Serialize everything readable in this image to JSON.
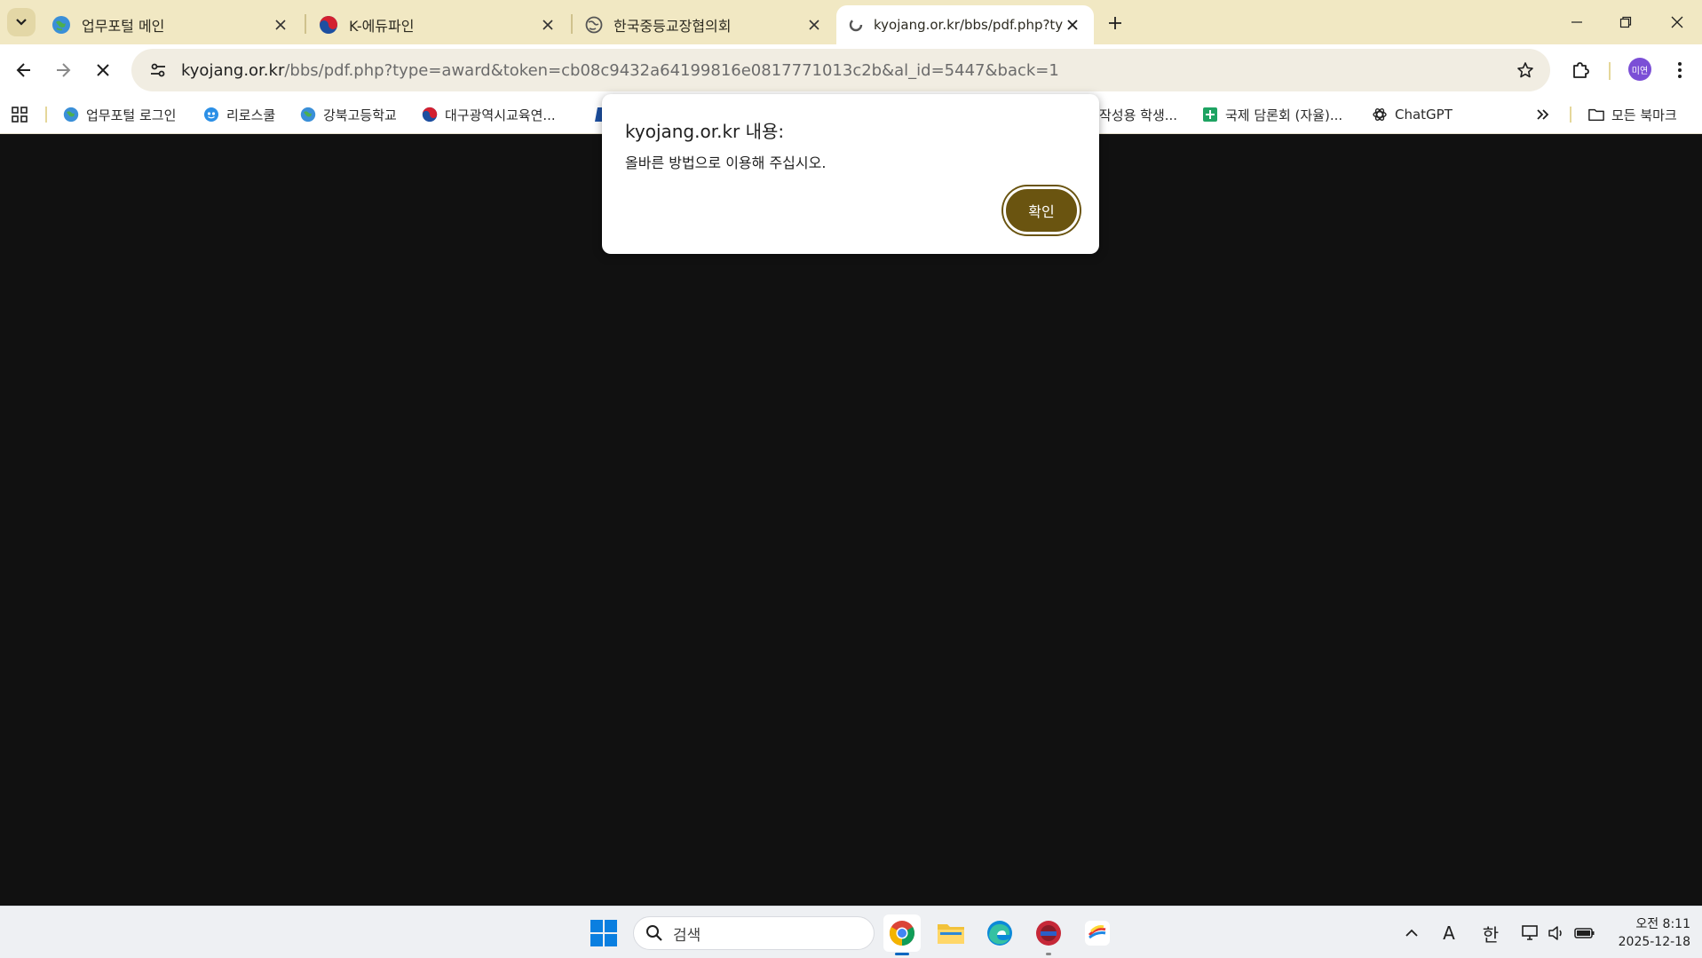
{
  "tabs": [
    {
      "title": "업무포털 메인",
      "icon": "globe-icon"
    },
    {
      "title": "K-에듀파인",
      "icon": "taegeuk-icon"
    },
    {
      "title": "한국중등교장협의회",
      "icon": "globe-gray-icon"
    },
    {
      "title": "kyojang.or.kr/bbs/pdf.php?type=award",
      "icon": "loading-icon",
      "active": true
    }
  ],
  "url": {
    "host": "kyojang.or.kr",
    "path": "/bbs/pdf.php?type=award&token=cb08c9432a64199816e0817771013c2b&al_id=5447&back=1"
  },
  "profile": {
    "initials": "미연",
    "color": "#7b4fd6"
  },
  "bookmarks": [
    {
      "label": "업무포털 로그인",
      "icon": "globe-icon"
    },
    {
      "label": "리로스쿨",
      "icon": "riro-icon"
    },
    {
      "label": "강북고등학교",
      "icon": "globe-icon"
    },
    {
      "label": "대구광역시교육연...",
      "icon": "taegeuk-icon"
    },
    {
      "label": "작성용 학생...",
      "icon": ""
    },
    {
      "label": "국제 담론회 (자율)...",
      "icon": "sheets-icon"
    },
    {
      "label": "ChatGPT",
      "icon": "openai-icon"
    }
  ],
  "all_bookmarks_label": "모든 북마크",
  "dialog": {
    "title": "kyojang.or.kr 내용:",
    "message": "올바른 방법으로 이용해 주십시오.",
    "ok_label": "확인"
  },
  "taskbar": {
    "search_placeholder": "검색",
    "ime_a": "A",
    "ime_han": "한",
    "time": "오전 8:11",
    "date": "2025-12-18"
  },
  "colors": {
    "tabstrip": "#f1e8c3",
    "dialog_button": "#6a5410",
    "page_background": "#111111"
  }
}
